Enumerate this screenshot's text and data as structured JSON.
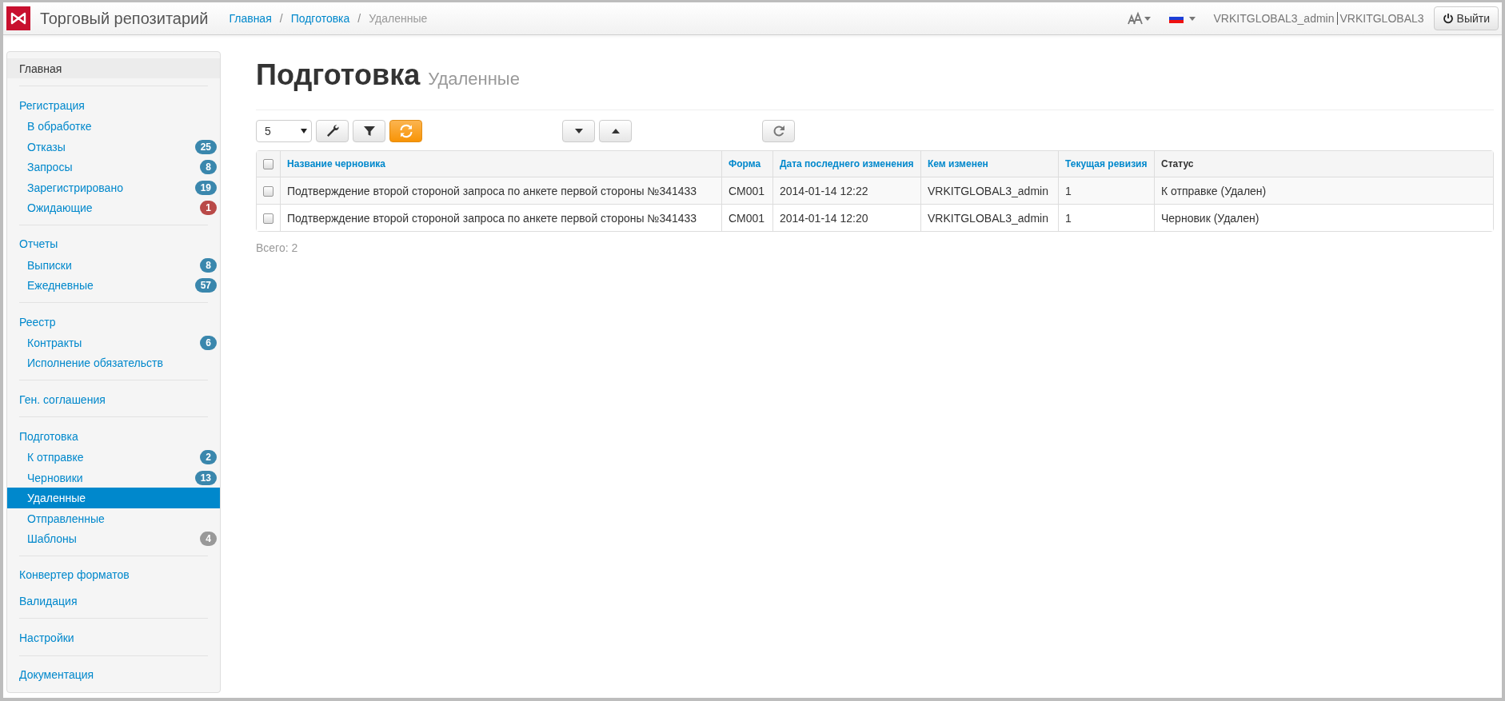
{
  "topbar": {
    "app_title": "Торговый репозитарий",
    "breadcrumbs": [
      {
        "label": "Главная",
        "current": false
      },
      {
        "separator": "/",
        "label": "Подготовка",
        "current": false
      },
      {
        "separator": "/",
        "label": "Удаленные",
        "current": true
      }
    ],
    "user": "VRKITGLOBAL3_admin",
    "organization": "VRKITGLOBAL3",
    "logout": "Выйти"
  },
  "sidebar": {
    "groups": [
      [
        {
          "kind": "header",
          "label": "Главная",
          "selected": false,
          "active": true
        }
      ],
      [
        {
          "kind": "header",
          "label": "Регистрация",
          "selected": false
        },
        {
          "kind": "sub",
          "label": "В обработке",
          "selected": false
        },
        {
          "kind": "sub",
          "label": "Отказы",
          "selected": false,
          "badge": "25",
          "color": "#3a87ad"
        },
        {
          "kind": "sub",
          "label": "Запросы",
          "selected": false,
          "badge": "8",
          "color": "#3a87ad"
        },
        {
          "kind": "sub",
          "label": "Зарегистрировано",
          "selected": false,
          "badge": "19",
          "color": "#3a87ad"
        },
        {
          "kind": "sub",
          "label": "Ожидающие",
          "selected": false,
          "badge": "1",
          "color": "#b94a48"
        }
      ],
      [
        {
          "kind": "header",
          "label": "Отчеты",
          "selected": false
        },
        {
          "kind": "sub",
          "label": "Выписки",
          "selected": false,
          "badge": "8",
          "color": "#3a87ad"
        },
        {
          "kind": "sub",
          "label": "Ежедневные",
          "selected": false,
          "badge": "57",
          "color": "#3a87ad"
        }
      ],
      [
        {
          "kind": "header",
          "label": "Реестр",
          "selected": false
        },
        {
          "kind": "sub",
          "label": "Контракты",
          "selected": false,
          "badge": "6",
          "color": "#3a87ad"
        },
        {
          "kind": "sub",
          "label": "Исполнение обязательств",
          "selected": false
        }
      ],
      [
        {
          "kind": "header",
          "label": "Ген. соглашения",
          "selected": false
        }
      ],
      [
        {
          "kind": "header",
          "label": "Подготовка",
          "selected": false
        },
        {
          "kind": "sub",
          "label": "К отправке",
          "selected": false,
          "badge": "2",
          "color": "#3a87ad"
        },
        {
          "kind": "sub",
          "label": "Черновики",
          "selected": false,
          "badge": "13",
          "color": "#3a87ad"
        },
        {
          "kind": "sub",
          "label": "Удаленные",
          "selected": true
        },
        {
          "kind": "sub",
          "label": "Отправленные",
          "selected": false
        },
        {
          "kind": "sub",
          "label": "Шаблоны",
          "selected": false,
          "badge": "4",
          "color": "#999999"
        }
      ],
      [
        {
          "kind": "header",
          "label": "Конвертер форматов",
          "selected": false
        },
        {
          "kind": "header",
          "label": "Валидация",
          "selected": false
        }
      ],
      [
        {
          "kind": "header",
          "label": "Настройки",
          "selected": false
        }
      ],
      [
        {
          "kind": "header",
          "label": "Документация",
          "selected": false
        }
      ]
    ]
  },
  "page": {
    "title": "Подготовка",
    "subtitle": "Удаленные"
  },
  "toolbar": {
    "page_size": "5",
    "groups": [
      [
        {
          "kind": "settings",
          "active": false
        },
        {
          "kind": "filter",
          "active": false
        },
        {
          "kind": "sync",
          "active": true
        }
      ],
      [
        {
          "kind": "expand",
          "active": false
        },
        {
          "kind": "collapse",
          "active": false
        }
      ],
      [
        {
          "kind": "reload",
          "active": false
        }
      ]
    ]
  },
  "table": {
    "all_checked": false,
    "columns": [
      {
        "label": "Название черновика",
        "sortable": true
      },
      {
        "label": "Форма",
        "sortable": true
      },
      {
        "label": "Дата последнего изменения",
        "sortable": true
      },
      {
        "label": "Кем изменен",
        "sortable": true
      },
      {
        "label": "Текущая ревизия",
        "sortable": true
      },
      {
        "label": "Статус",
        "sortable": false
      }
    ],
    "rows": [
      {
        "checked": false,
        "cells": [
          "Подтверждение второй стороной запроса по анкете первой стороны №341433",
          "CM001",
          "2014-01-14 12:22",
          "VRKITGLOBAL3_admin",
          "1",
          "К отправке (Удален)"
        ]
      },
      {
        "checked": false,
        "cells": [
          "Подтверждение второй стороной запроса по анкете первой стороны №341433",
          "CM001",
          "2014-01-14 12:20",
          "VRKITGLOBAL3_admin",
          "1",
          "Черновик (Удален)"
        ]
      }
    ]
  },
  "total": "Всего: 2"
}
